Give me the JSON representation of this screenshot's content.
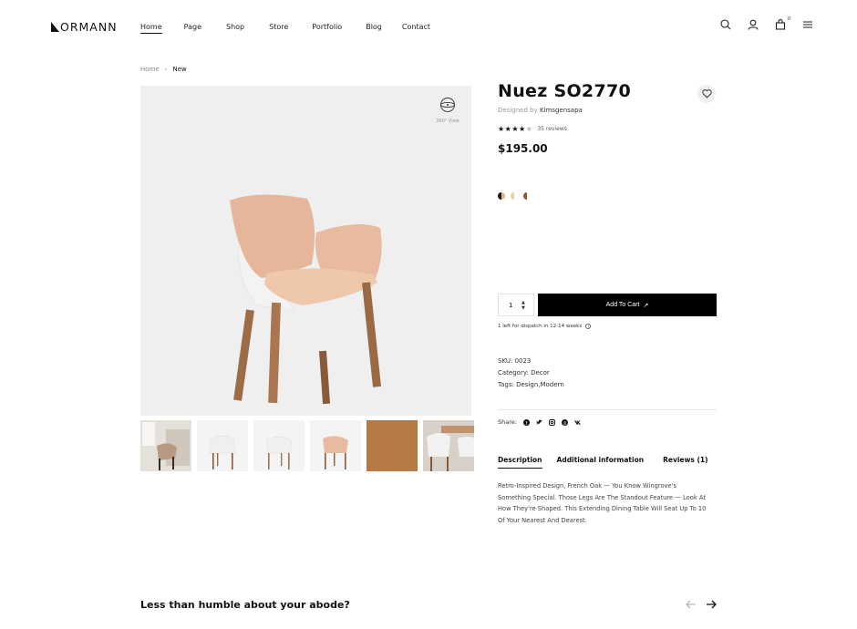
{
  "brand": {
    "logo_text": "ORMANN",
    "logo_glyph": "N"
  },
  "nav": {
    "items": [
      {
        "label": "Home",
        "active": true
      },
      {
        "label": "Page"
      },
      {
        "label": "Shop"
      },
      {
        "label": "Store"
      },
      {
        "label": "Portfolio"
      },
      {
        "label": "Blog"
      },
      {
        "label": "Contact"
      }
    ]
  },
  "header_icons": {
    "search": "search-icon",
    "account": "user-icon",
    "cart": "bag-icon",
    "cart_count": "0",
    "menu": "hamburger-icon"
  },
  "breadcrumb": {
    "home": "Home",
    "separator": "›",
    "current": "New"
  },
  "gallery": {
    "view360_label": "360° View",
    "thumbnails": [
      "thumb-room",
      "thumb-white-front",
      "thumb-white-side",
      "thumb-beige",
      "thumb-fabric",
      "thumb-dining"
    ]
  },
  "product": {
    "title": "Nuez SO2770",
    "designed_prefix": "Designed by",
    "designer": "Kimsgensapa",
    "rating_stars": 4,
    "rating_max": 5,
    "reviews_text": "35 reviews",
    "price": "$195.00",
    "swatches": [
      {
        "left": "#1a1a1a",
        "right": "#d9b98a"
      },
      {
        "left": "#e8d2a8",
        "right": "#ffffff"
      },
      {
        "left": "#8a5a35",
        "right": "#ffffff"
      }
    ],
    "quantity": "1",
    "add_to_cart_label": "Add To Cart",
    "dispatch_text": "1 left for dispatch in 12-14 weeks",
    "sku_label": "SKU:",
    "sku": "0023",
    "category_label": "Category:",
    "category": "Decor",
    "tags_label": "Tags:",
    "tags": "Design,Modern",
    "share_label": "Share:"
  },
  "tabs": {
    "description": "Description",
    "additional": "Additional information",
    "reviews": "Reviews (1)"
  },
  "description_text": "Retro-Inspired Design, French Oak — You Know Wingrove's Something Special. Those Legs Are The Standout Feature — Look At How They're Shaped. This Extending Dining Table Will Seat Up To 10 Of Your Nearest And Dearest.",
  "section": {
    "title": "Less than humble about your abode?"
  },
  "colors": {
    "accent": "#000000",
    "muted": "#999999",
    "image_bg": "#efefef"
  }
}
